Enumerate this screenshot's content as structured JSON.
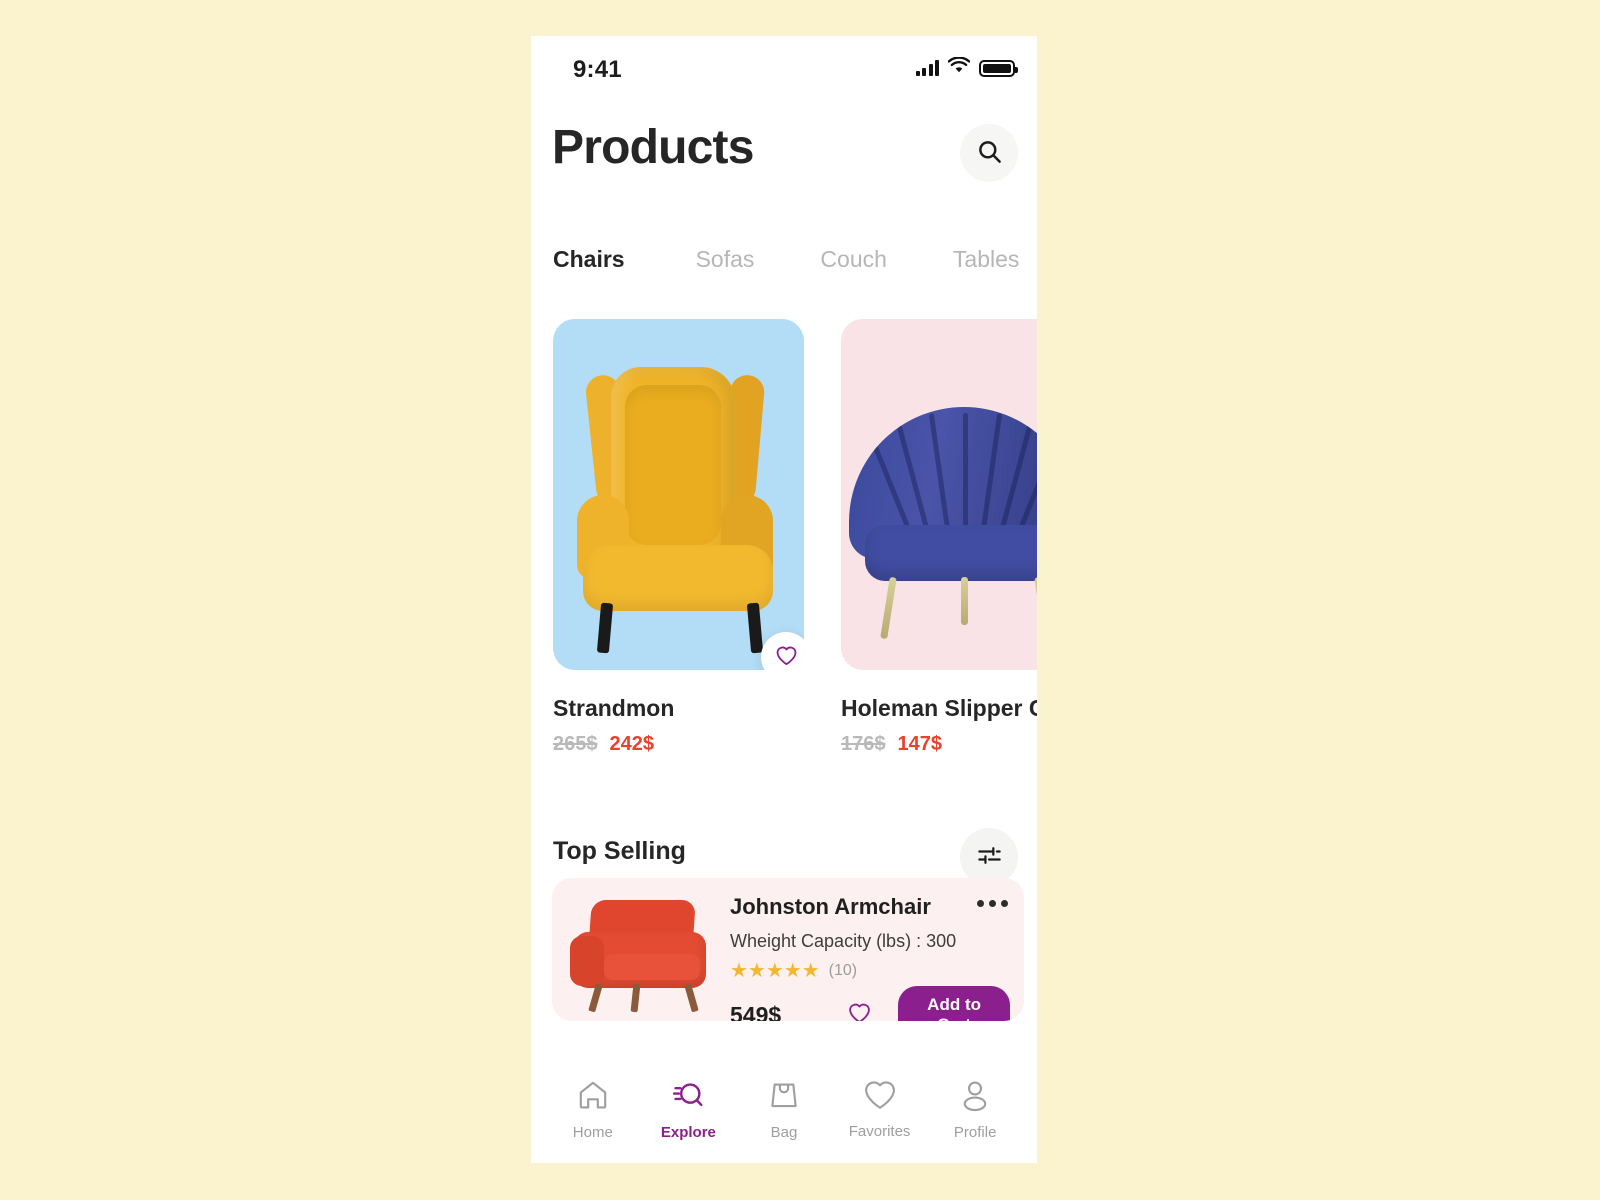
{
  "statusbar": {
    "time": "9:41",
    "icons": [
      "cellular-signal-icon",
      "wifi-icon",
      "battery-icon"
    ]
  },
  "header": {
    "title": "Products",
    "search_icon": "search-icon"
  },
  "tabs": [
    {
      "label": "Chairs",
      "active": true
    },
    {
      "label": "Sofas",
      "active": false
    },
    {
      "label": "Couch",
      "active": false
    },
    {
      "label": "Tables",
      "active": false
    }
  ],
  "products": [
    {
      "name": "Strandmon",
      "price_old": "265$",
      "price_new": "242$",
      "bg": "#b3dcf7",
      "favorite_icon": "heart-icon"
    },
    {
      "name": "Holeman Slipper Chair",
      "price_old": "176$",
      "price_new": "147$",
      "bg": "#fae3e6",
      "favorite_icon": "heart-icon"
    }
  ],
  "section": {
    "title": "Top Selling",
    "filter_icon": "sliders-filter-icon"
  },
  "top_selling": {
    "name": "Johnston Armchair",
    "spec": "Wheight Capacity (lbs) : 300",
    "stars": "★★★★★",
    "review_count": "(10)",
    "price": "549$",
    "favorite_icon": "heart-icon",
    "add_to_cart_label": "Add to Cart",
    "more_icon": "more-dots-icon"
  },
  "bottomnav": [
    {
      "label": "Home",
      "icon": "home-icon",
      "active": false
    },
    {
      "label": "Explore",
      "icon": "explore-search-icon",
      "active": true
    },
    {
      "label": "Bag",
      "icon": "bag-icon",
      "active": false
    },
    {
      "label": "Favorites",
      "icon": "heart-icon",
      "active": false
    },
    {
      "label": "Profile",
      "icon": "person-icon",
      "active": false
    }
  ],
  "colors": {
    "page_background": "#faf3cd",
    "accent_purple": "#8b1f8d",
    "price_red": "#e8412c",
    "star_yellow": "#f2b830",
    "text_dark": "#262626",
    "text_muted": "#b6b6b6"
  }
}
